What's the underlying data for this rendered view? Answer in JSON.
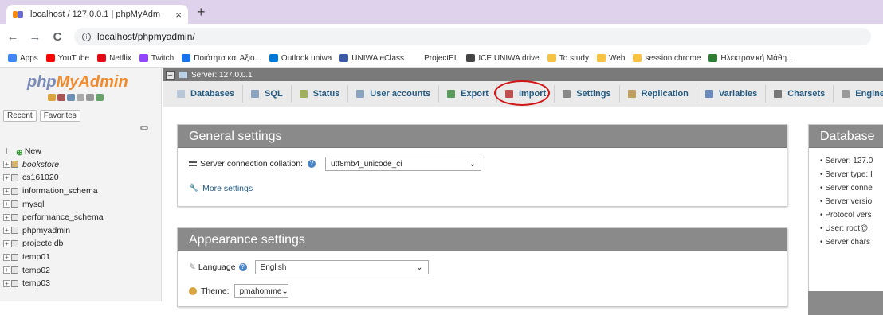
{
  "browser": {
    "tab_title": "localhost / 127.0.0.1 | phpMyAdm",
    "tab_close": "×",
    "new_tab": "+",
    "back": "←",
    "forward": "→",
    "reload": "C",
    "url": "localhost/phpmyadmin/",
    "bookmarks": [
      {
        "label": "Apps",
        "color": "#4285f4"
      },
      {
        "label": "YouTube",
        "color": "#ff0000"
      },
      {
        "label": "Netflix",
        "color": "#e50914"
      },
      {
        "label": "Twitch",
        "color": "#9146ff"
      },
      {
        "label": "Ποιότητα και Αξιο...",
        "color": "#1a73e8"
      },
      {
        "label": "Outlook uniwa",
        "color": "#0078d4"
      },
      {
        "label": "UNIWA eClass",
        "color": "#3b5ba5"
      },
      {
        "label": "ProjectEL",
        "color": "#ffffff"
      },
      {
        "label": "ICE UNIWA drive",
        "color": "#444444"
      },
      {
        "label": "To study",
        "color": "#f6c342"
      },
      {
        "label": "Web",
        "color": "#f6c342"
      },
      {
        "label": "session chrome",
        "color": "#f6c342"
      },
      {
        "label": "Ηλεκτρονική Μάθη...",
        "color": "#2e7d32"
      }
    ]
  },
  "pma": {
    "logo_a": "php",
    "logo_b": "MyAdmin",
    "recent": "Recent",
    "favorites": "Favorites",
    "databases": [
      {
        "name": "New",
        "kind": "new"
      },
      {
        "name": "bookstore",
        "kind": "book"
      },
      {
        "name": "cs161020",
        "kind": "db"
      },
      {
        "name": "information_schema",
        "kind": "db"
      },
      {
        "name": "mysql",
        "kind": "db"
      },
      {
        "name": "performance_schema",
        "kind": "db"
      },
      {
        "name": "phpmyadmin",
        "kind": "db"
      },
      {
        "name": "projecteldb",
        "kind": "db"
      },
      {
        "name": "temp01",
        "kind": "db"
      },
      {
        "name": "temp02",
        "kind": "db"
      },
      {
        "name": "temp03",
        "kind": "db"
      }
    ],
    "server_label": "Server: 127.0.0.1",
    "tabs": [
      {
        "label": "Databases",
        "color": "#b8c8d8"
      },
      {
        "label": "SQL",
        "color": "#8aa4c0"
      },
      {
        "label": "Status",
        "color": "#a0b060"
      },
      {
        "label": "User accounts",
        "color": "#8aa4c0"
      },
      {
        "label": "Export",
        "color": "#5a9a5a"
      },
      {
        "label": "Import",
        "color": "#c05050"
      },
      {
        "label": "Settings",
        "color": "#888888"
      },
      {
        "label": "Replication",
        "color": "#c0a060"
      },
      {
        "label": "Variables",
        "color": "#6a8abb"
      },
      {
        "label": "Charsets",
        "color": "#777777"
      },
      {
        "label": "Engines",
        "color": "#999999"
      }
    ],
    "general": {
      "title": "General settings",
      "collation_label": "Server connection collation:",
      "collation_value": "utf8mb4_unicode_ci",
      "more": "More settings"
    },
    "appearance": {
      "title": "Appearance settings",
      "language_label": "Language",
      "language_value": "English",
      "theme_label": "Theme:",
      "theme_value": "pmahomme"
    },
    "database_server": {
      "title": "Database",
      "items": [
        "Server: 127.0",
        "Server type: I",
        "Server conne",
        "Server versio",
        "Protocol vers",
        "User: root@l",
        "Server chars"
      ]
    }
  }
}
